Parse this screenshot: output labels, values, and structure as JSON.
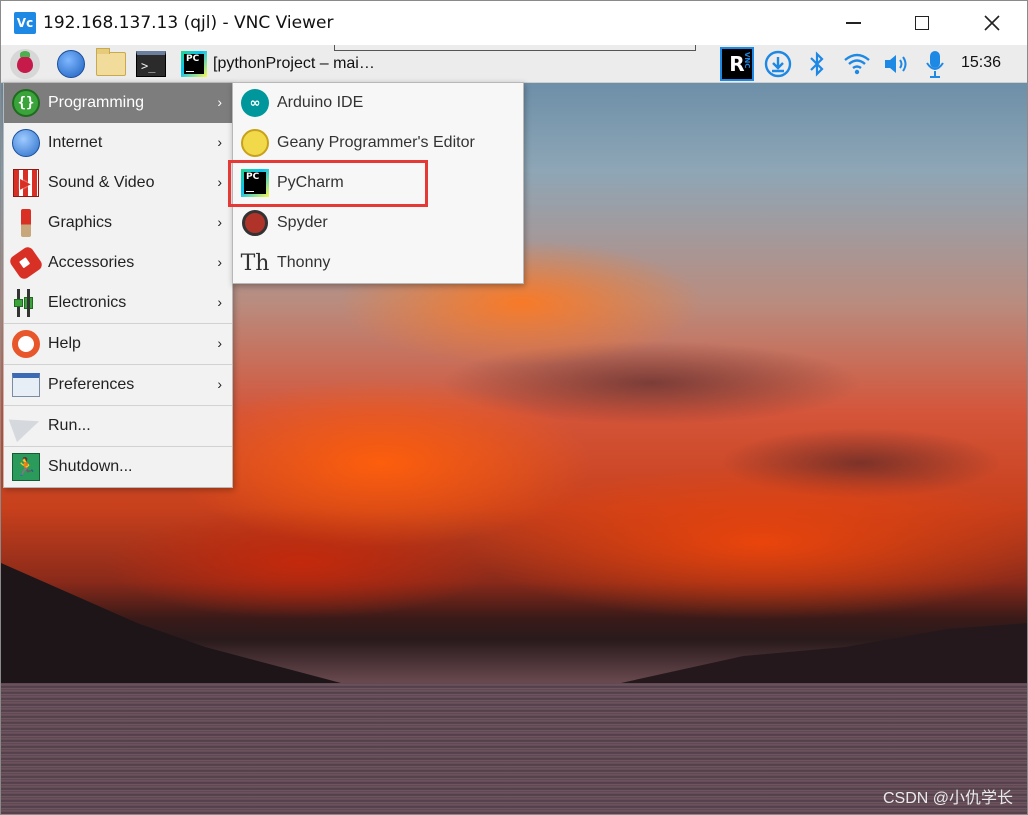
{
  "window": {
    "title": "192.168.137.13 (qjl) - VNC Viewer",
    "logo_text": "Vc"
  },
  "panel": {
    "terminal_glyph": ">_",
    "taskbar_app_label": "[pythonProject – mai…",
    "realvnc_letter": "R",
    "realvnc_small": "VNC",
    "clock": "15:36"
  },
  "main_menu": {
    "items": [
      {
        "label": "Programming",
        "icon": "programming-icon",
        "submenu": true,
        "active": true
      },
      {
        "label": "Internet",
        "icon": "internet-icon",
        "submenu": true
      },
      {
        "label": "Sound & Video",
        "icon": "sound-video-icon",
        "submenu": true
      },
      {
        "label": "Graphics",
        "icon": "graphics-icon",
        "submenu": true
      },
      {
        "label": "Accessories",
        "icon": "accessories-icon",
        "submenu": true
      },
      {
        "label": "Electronics",
        "icon": "electronics-icon",
        "submenu": true
      },
      {
        "label": "Help",
        "icon": "help-icon",
        "submenu": true
      },
      {
        "label": "Preferences",
        "icon": "preferences-icon",
        "submenu": true
      },
      {
        "label": "Run...",
        "icon": "run-icon",
        "submenu": false
      },
      {
        "label": "Shutdown...",
        "icon": "shutdown-icon",
        "submenu": false
      }
    ],
    "arrow_glyph": "›"
  },
  "programming_submenu": {
    "items": [
      {
        "label": "Arduino IDE",
        "icon": "arduino-icon"
      },
      {
        "label": "Geany Programmer's Editor",
        "icon": "geany-icon"
      },
      {
        "label": "PyCharm",
        "icon": "pycharm-icon",
        "highlighted": true
      },
      {
        "label": "Spyder",
        "icon": "spyder-icon"
      },
      {
        "label": "Thonny",
        "icon": "thonny-icon"
      }
    ],
    "arduino_glyph": "∞",
    "thonny_glyph": "Th",
    "pycharm_logo_text": "PC"
  },
  "watermark": "CSDN @小仇学长",
  "colors": {
    "highlight_border": "#e53935",
    "menu_active_bg": "#7d7d7d",
    "panel_bg": "#ececec"
  }
}
